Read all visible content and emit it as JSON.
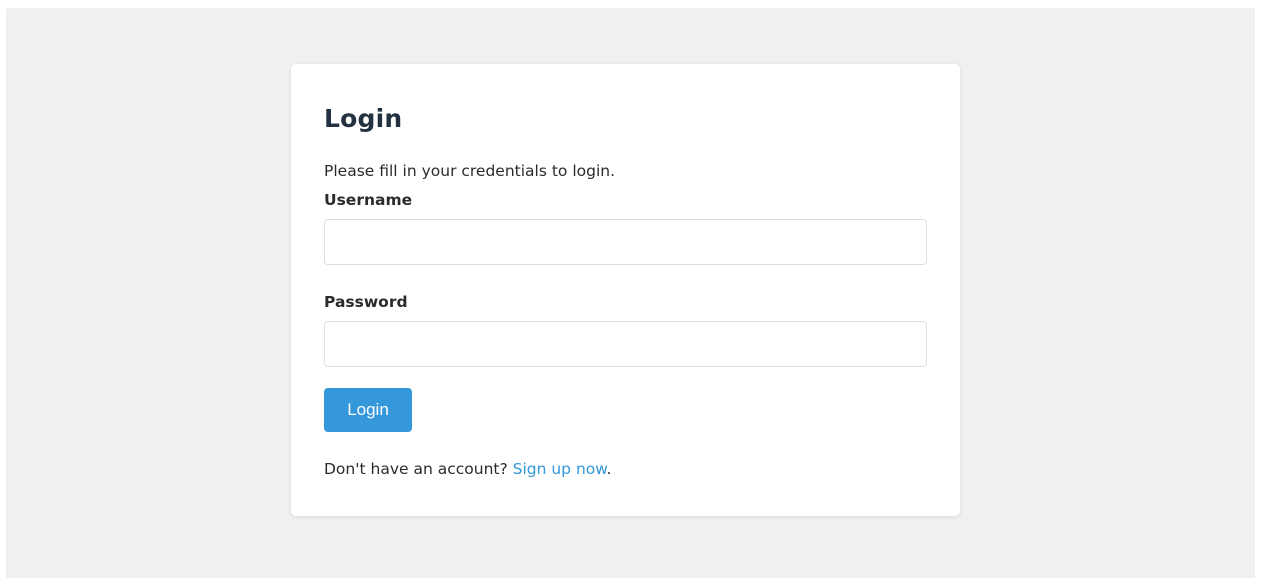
{
  "form": {
    "title": "Login",
    "subtitle": "Please fill in your credentials to login.",
    "username_label": "Username",
    "username_value": "",
    "username_placeholder": "",
    "password_label": "Password",
    "password_value": "",
    "password_placeholder": "",
    "submit_label": "Login"
  },
  "footer": {
    "prompt": "Don't have an account? ",
    "link_label": "Sign up now",
    "suffix": "."
  },
  "colors": {
    "accent": "#3498db",
    "title": "#233140",
    "background": "#f0f0f0"
  }
}
